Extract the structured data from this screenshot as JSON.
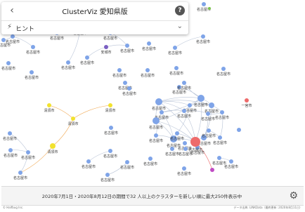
{
  "header": {
    "back_icon": "chevron-left-icon",
    "title": "ClusterViz 愛知県版",
    "help_icon": "question-circle-icon",
    "help_glyph": "?"
  },
  "hint": {
    "icon": "lightning-bolt-icon",
    "label": "ヒント",
    "chevron_icon": "chevron-down-icon"
  },
  "footer": {
    "text": "2020年7月1日・2020年8月12日の期間で32 人以上のクラスターを新しい順に最大250件表示中",
    "settings_icon": "gear-icon"
  },
  "credits": {
    "left": "© Halfbug Inc.",
    "right": "データ出典: LINKData（最終更新: 2020年8月11日）"
  },
  "colors": {
    "node_blue": "#7fa4e8",
    "node_green": "#7bc44a",
    "node_purple": "#7a5fc2",
    "node_red": "#ee6b6b",
    "node_yellow": "#f2e22e",
    "node_magenta": "#c04cc4",
    "edge_grey": "#b8c3d6",
    "edge_orange": "#f0a44a",
    "edge_red": "#ee6b6b"
  },
  "graph": {
    "nodes": [
      {
        "id": "n1",
        "label": "名古屋市",
        "color": "blue"
      },
      {
        "id": "n2",
        "label": "名古屋市",
        "color": "blue"
      },
      {
        "id": "n3",
        "label": "名古屋市",
        "color": "blue"
      },
      {
        "id": "n4",
        "label": "名古屋市",
        "color": "blue"
      },
      {
        "id": "n5",
        "label": "名古屋市",
        "color": "blue"
      },
      {
        "id": "n6",
        "label": "名古屋市",
        "color": "blue"
      },
      {
        "id": "n7",
        "label": "名古屋市",
        "color": "blue"
      },
      {
        "id": "n8",
        "label": "名古屋市",
        "color": "blue"
      },
      {
        "id": "n9",
        "label": "名古屋市",
        "color": "blue"
      },
      {
        "id": "n10",
        "label": "名古屋市",
        "color": "blue"
      },
      {
        "id": "n11",
        "label": "名古屋市",
        "color": "blue"
      },
      {
        "id": "n12",
        "label": "安城市",
        "color": "purple"
      },
      {
        "id": "n13",
        "label": "名古屋市",
        "color": "blue"
      },
      {
        "id": "n14",
        "label": "名古屋市",
        "color": "blue"
      },
      {
        "id": "n15",
        "label": "名古屋市",
        "color": "blue"
      },
      {
        "id": "n16",
        "label": "名古屋市",
        "color": "blue"
      },
      {
        "id": "n17",
        "label": "名古屋市",
        "color": "blue"
      },
      {
        "id": "n18",
        "label": "名古屋市",
        "color": "blue"
      },
      {
        "id": "n19",
        "label": "名古屋市",
        "color": "blue"
      },
      {
        "id": "n20",
        "label": "名古屋市",
        "color": "blue"
      },
      {
        "id": "n21",
        "label": "名古屋市",
        "color": "blue"
      },
      {
        "id": "n22",
        "label": "名古屋市",
        "color": "blue"
      },
      {
        "id": "n23",
        "label": "名古屋市",
        "color": "blue"
      },
      {
        "id": "n24",
        "label": "名古屋市",
        "color": "blue"
      },
      {
        "id": "n25",
        "label": "名古屋市",
        "color": "blue"
      },
      {
        "id": "n26",
        "label": "名古屋市",
        "color": "blue"
      },
      {
        "id": "n27",
        "label": "名古屋市",
        "color": "blue"
      },
      {
        "id": "n28",
        "label": "名古屋市",
        "color": "blue"
      },
      {
        "id": "n29",
        "label": "名古屋市",
        "color": "blue"
      },
      {
        "id": "n30",
        "label": "名古屋市",
        "color": "blue"
      },
      {
        "id": "n31",
        "label": "名古屋市",
        "color": "blue"
      },
      {
        "id": "n32",
        "label": "一宮市",
        "color": "red"
      },
      {
        "id": "n33",
        "label": "名古屋市",
        "color": "blue"
      },
      {
        "id": "n34",
        "label": "名古屋市",
        "color": "blue"
      },
      {
        "id": "n35",
        "label": "名古屋市",
        "color": "blue"
      },
      {
        "id": "n36",
        "label": "名古屋市",
        "color": "blue"
      },
      {
        "id": "n37",
        "label": "清須市",
        "color": "yellow"
      },
      {
        "id": "n38",
        "label": "清須市",
        "color": "yellow"
      },
      {
        "id": "n39",
        "label": "清須市",
        "color": "yellow"
      },
      {
        "id": "n40",
        "label": "清須市",
        "color": "yellow"
      },
      {
        "id": "n41",
        "label": "名古屋市",
        "color": "blue"
      },
      {
        "id": "n42",
        "label": "名古屋市",
        "color": "blue"
      },
      {
        "id": "n43",
        "label": "名古屋市",
        "color": "blue"
      },
      {
        "id": "n44",
        "label": "名古屋市",
        "color": "blue"
      },
      {
        "id": "n45",
        "label": "名古屋市",
        "color": "blue"
      },
      {
        "id": "n46",
        "label": "名古屋市",
        "color": "blue"
      },
      {
        "id": "n47",
        "label": "名古屋市",
        "color": "blue"
      },
      {
        "id": "n48",
        "label": "名古屋市",
        "color": "blue"
      },
      {
        "id": "n49",
        "label": "名古屋市",
        "color": "blue"
      },
      {
        "id": "n50",
        "label": "名古屋市",
        "color": "blue"
      },
      {
        "id": "n51",
        "label": "名古屋市",
        "color": "blue"
      },
      {
        "id": "n52",
        "label": "名古屋市",
        "color": "blue"
      },
      {
        "id": "n53",
        "label": "名古屋市",
        "color": "blue"
      },
      {
        "id": "n54",
        "label": "名古屋市",
        "color": "blue"
      },
      {
        "id": "n55",
        "label": "名古屋市",
        "color": "blue"
      },
      {
        "id": "n56",
        "label": "名古屋市",
        "color": "red"
      },
      {
        "id": "n57",
        "label": "名古屋市",
        "color": "blue"
      },
      {
        "id": "n58",
        "label": "名古屋市",
        "color": "blue"
      },
      {
        "id": "n59",
        "label": "名古屋市",
        "color": "blue"
      },
      {
        "id": "n60",
        "label": "名古屋市",
        "color": "blue"
      },
      {
        "id": "n61",
        "label": "名古屋市",
        "color": "blue"
      },
      {
        "id": "n62",
        "label": "名古屋市",
        "color": "blue"
      },
      {
        "id": "n63",
        "label": "名古屋市",
        "color": "blue"
      },
      {
        "id": "n64",
        "label": "名古屋市",
        "color": "blue"
      },
      {
        "id": "n65",
        "label": "",
        "color": "magenta"
      },
      {
        "id": "n66",
        "label": "",
        "color": "green"
      },
      {
        "id": "n67",
        "label": "",
        "color": "blue"
      }
    ]
  }
}
